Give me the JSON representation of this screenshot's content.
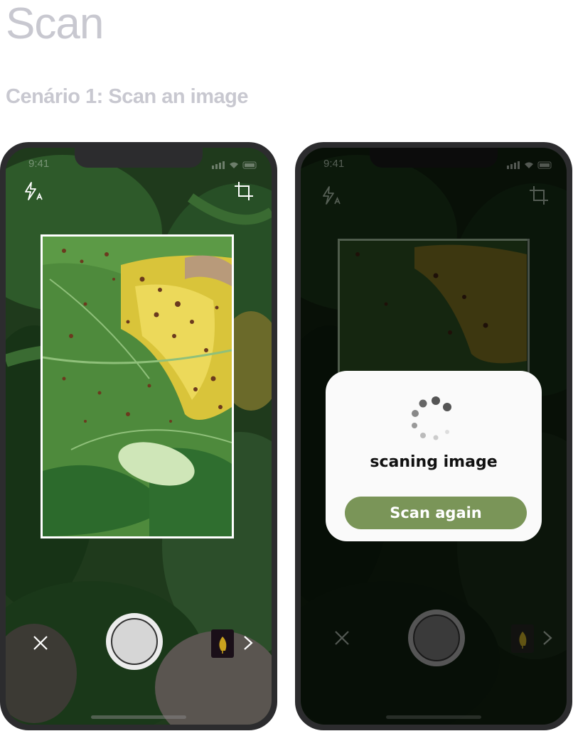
{
  "page": {
    "title": "Scan",
    "subtitle": "Cenário 1: Scan an image"
  },
  "phone_left": {
    "status_time": "9:41",
    "flash_icon": "flash-auto-icon",
    "crop_icon": "crop-icon",
    "close_icon": "close-icon",
    "next_icon": "chevron-right-icon"
  },
  "phone_right": {
    "status_time": "9:41",
    "dialog": {
      "message": "scaning image",
      "button_label": "Scan again"
    }
  },
  "colors": {
    "accent_green": "#7a9558",
    "title_gray": "#c8c8d0",
    "phone_frame": "#2c2c2e"
  }
}
